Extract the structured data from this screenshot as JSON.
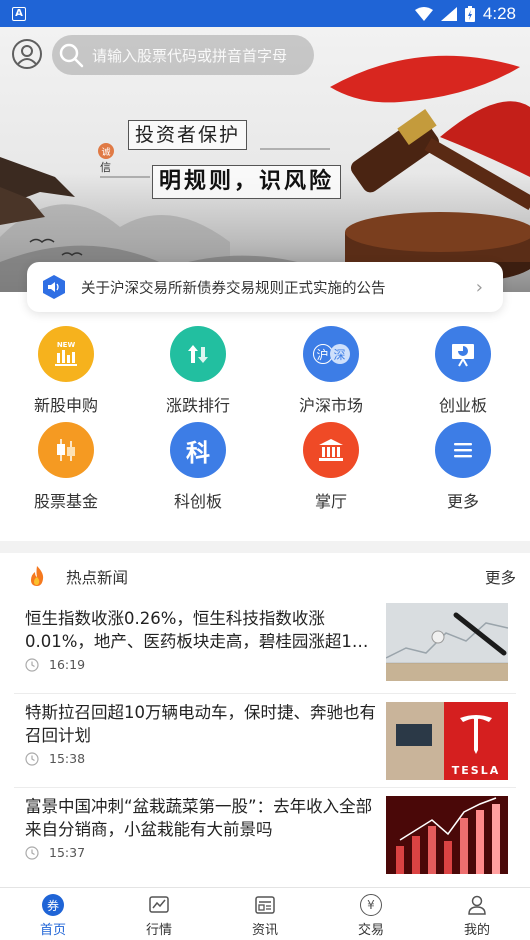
{
  "status_bar": {
    "time": "4:28"
  },
  "search": {
    "placeholder": "请输入股票代码或拼音首字母"
  },
  "banner": {
    "title": "投资者保护",
    "subtitle": "明规则，识风险",
    "seal": "诚",
    "seal_sub": "信"
  },
  "notice": {
    "text": "关于沪深交易所新债券交易规则正式实施的公告"
  },
  "shortcuts": [
    {
      "label": "新股申购",
      "icon": "new-stock-icon",
      "color": "#f6b21d",
      "badge": "NEW"
    },
    {
      "label": "涨跌排行",
      "icon": "up-down-arrows-icon",
      "color": "#22bfa0"
    },
    {
      "label": "沪深市场",
      "icon": "shanghai-shenzhen-icon",
      "color": "#3d7de6",
      "glyph_a": "沪",
      "glyph_b": "深"
    },
    {
      "label": "创业板",
      "icon": "presentation-board-icon",
      "color": "#3d7de6"
    },
    {
      "label": "股票基金",
      "icon": "candlestick-icon",
      "color": "#f59a22"
    },
    {
      "label": "科创板",
      "icon": "star-board-icon",
      "color": "#3d7de6",
      "glyph": "科"
    },
    {
      "label": "掌厅",
      "icon": "bank-building-icon",
      "color": "#ef4a26"
    },
    {
      "label": "更多",
      "icon": "menu-lines-icon",
      "color": "#3d7de6"
    }
  ],
  "news_section": {
    "title": "热点新闻",
    "more": "更多"
  },
  "news": [
    {
      "title": "恒生指数收涨0.26%，恒生科技指数收涨0.01%，地产、医药板块走高，碧桂园涨超1…",
      "time": "16:19",
      "thumb": "pen-and-chart-image"
    },
    {
      "title": "特斯拉召回超10万辆电动车，保时捷、奔驰也有召回计划",
      "time": "15:38",
      "thumb": "tesla-logo-image",
      "thumb_text": "TESLA"
    },
    {
      "title": "富景中国冲刺“盆栽蔬菜第一股”：去年收入全部来自分销商，小盆栽能有大前景吗",
      "time": "15:37",
      "thumb": "red-rising-chart-image"
    }
  ],
  "tabs": [
    {
      "label": "首页",
      "icon": "home-coupon-icon",
      "active": true,
      "glyph": "券"
    },
    {
      "label": "行情",
      "icon": "market-chart-icon"
    },
    {
      "label": "资讯",
      "icon": "news-doc-icon"
    },
    {
      "label": "交易",
      "icon": "trade-yen-icon",
      "glyph": "¥"
    },
    {
      "label": "我的",
      "icon": "profile-icon"
    }
  ],
  "colors": {
    "brand": "#1f64d6",
    "status_bar": "#1f64d6"
  }
}
